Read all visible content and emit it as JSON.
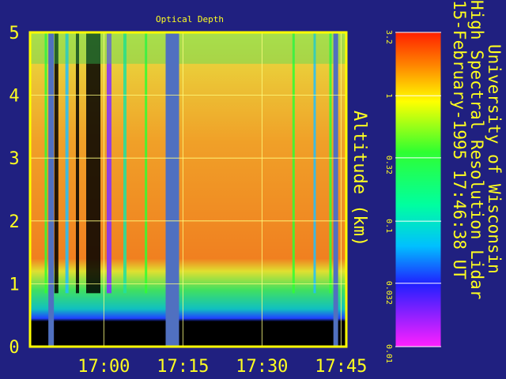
{
  "chart_data": {
    "type": "heatmap",
    "title": "Optical Depth",
    "ylabel": "Altitude (km)",
    "xlabel": "",
    "x_ticks": [
      "17:00",
      "17:15",
      "17:30",
      "17:45"
    ],
    "y_ticks": [
      "0",
      "1",
      "2",
      "3",
      "4",
      "5"
    ],
    "ylim": [
      0,
      5
    ],
    "grid": true,
    "colorbar": {
      "scale": "log",
      "ticks": [
        "3.2",
        "1",
        "0.32",
        "0.1",
        "0.032",
        "0.01"
      ],
      "range": [
        0.01,
        3.2
      ]
    },
    "gaps_time": [
      "16:50",
      "17:13",
      "17:44"
    ]
  },
  "info": {
    "institution": "University of Wisconsin",
    "instrument": "High Spectral Resolution Lidar",
    "timestamp": "15-February-1995 17:46:38 UT"
  },
  "colors": {
    "background": "#202080",
    "text": "#ffff20",
    "frame": "#ffff00",
    "gap": "#5070c0"
  }
}
